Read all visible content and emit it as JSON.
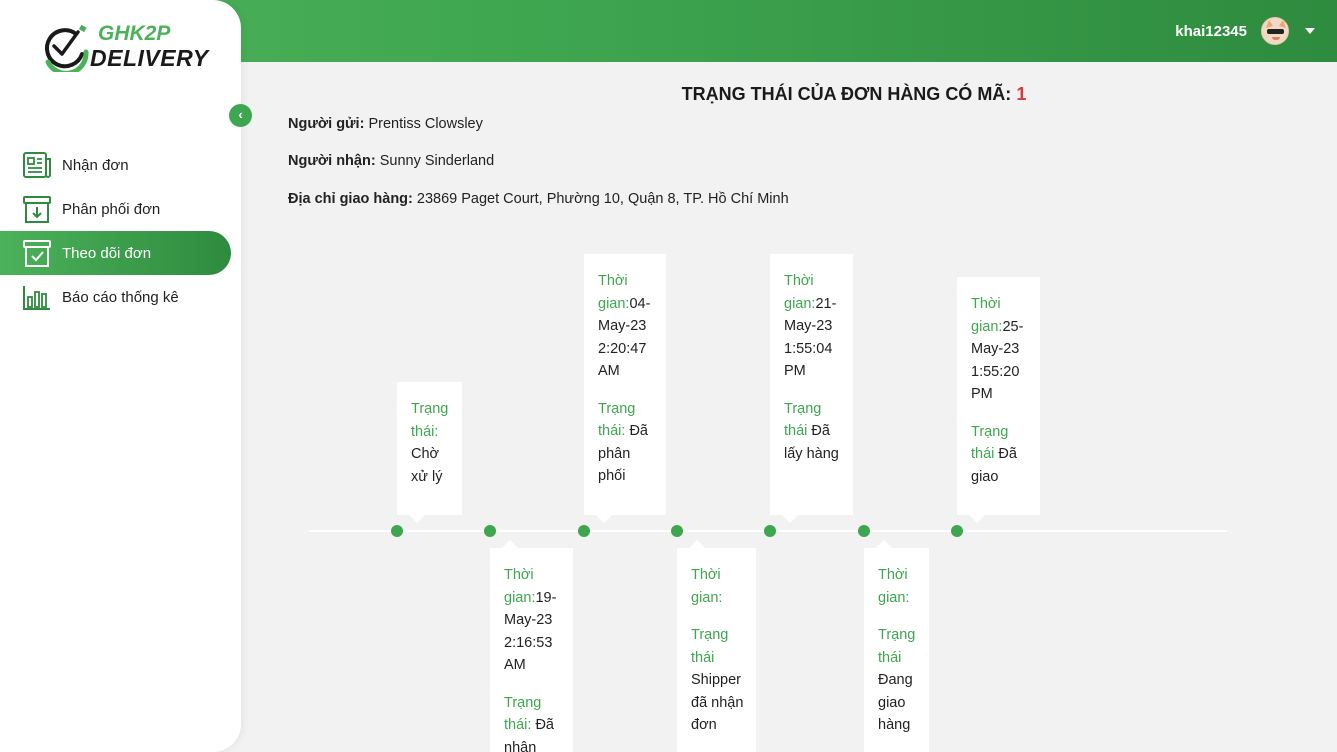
{
  "brand": {
    "line1": "GHK2P",
    "line2": "DELIVERY"
  },
  "header": {
    "username": "khai12345"
  },
  "sidebar": {
    "collapse_icon": "chevron-left-icon",
    "items": [
      {
        "label": "Nhận đơn",
        "icon": "newspaper-icon",
        "active": false
      },
      {
        "label": "Phân phối đơn",
        "icon": "archive-download-icon",
        "active": false
      },
      {
        "label": "Theo dõi đơn",
        "icon": "archive-check-icon",
        "active": true
      },
      {
        "label": "Báo cáo thống kê",
        "icon": "bar-chart-icon",
        "active": false
      }
    ]
  },
  "order": {
    "title": "TRẠNG THÁI CỦA ĐƠN HÀNG CÓ MÃ:",
    "code": "1",
    "sender_label": "Người gửi:",
    "sender": "Prentiss Clowsley",
    "receiver_label": "Người nhận:",
    "receiver": "Sunny Sinderland",
    "address_label": "Địa chỉ giao hàng:",
    "address": "23869 Paget Court, Phường 10, Quận 8, TP. Hồ Chí Minh"
  },
  "timeline": [
    {
      "time_label": "",
      "time": "",
      "status_label": "Trạng thái:",
      "status": "Chờ xử lý"
    },
    {
      "time_label": "Thời gian:",
      "time": "19-May-23 2:16:53 AM",
      "status_label": "Trạng thái:",
      "status": "Đã nhận"
    },
    {
      "time_label": "Thời gian:",
      "time": "04-May-23 2:20:47 AM",
      "status_label": "Trạng thái:",
      "status": "Đã phân phối"
    },
    {
      "time_label": "Thời gian:",
      "time": "",
      "status_label": "Trạng thái",
      "status": "Shipper đã nhận đơn"
    },
    {
      "time_label": "Thời gian:",
      "time": "21-May-23 1:55:04 PM",
      "status_label": "Trạng thái",
      "status": "Đã lấy hàng"
    },
    {
      "time_label": "Thời gian:",
      "time": "",
      "status_label": "Trạng thái",
      "status": "Đang giao hàng"
    },
    {
      "time_label": "Thời gian:",
      "time": "25-May-23 1:55:20 PM",
      "status_label": "Trạng thái",
      "status": "Đã giao"
    }
  ],
  "colors": {
    "primary": "#3fa650",
    "accent_code": "#d63b3b"
  }
}
